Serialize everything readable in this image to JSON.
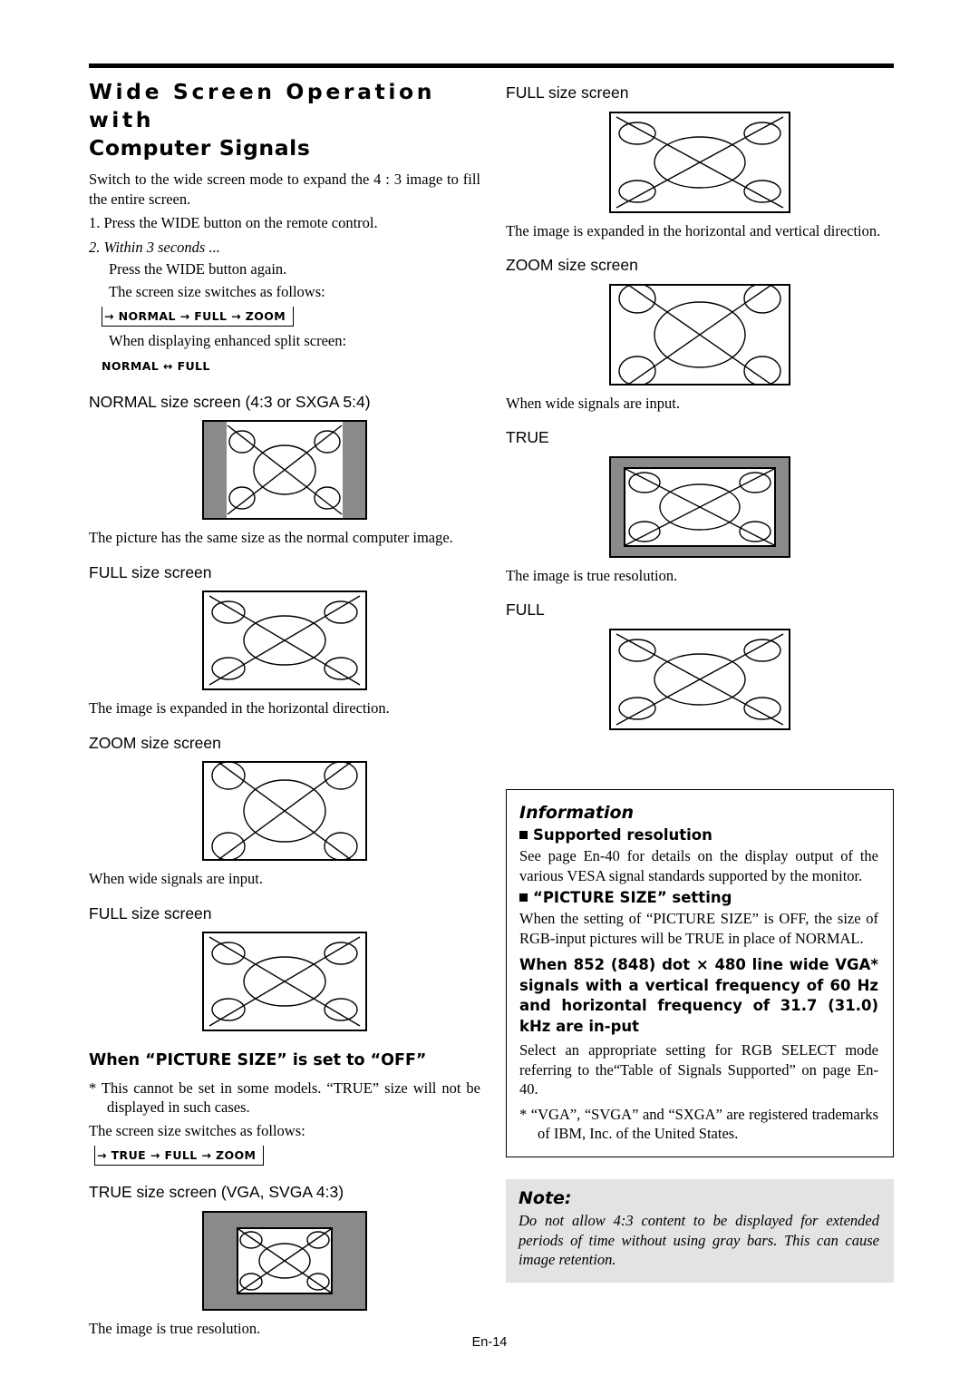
{
  "header": {
    "title_line1": "Wide  Screen  Operation  with",
    "title_line2": "Computer Signals"
  },
  "left": {
    "intro": "Switch to the wide screen mode to expand the 4 : 3 image to fill the entire screen.",
    "step1": "1. Press the WIDE button on the remote control.",
    "step2": "2. Within 3 seconds ...",
    "step2_line1": "Press the WIDE button again.",
    "step2_line2": "The screen size switches as follows:",
    "flow1": "→ NORMAL → FULL → ZOOM",
    "split_note": "When displaying enhanced split screen:",
    "flow2": "NORMAL ↔ FULL",
    "label_normal": "NORMAL size screen (4:3 or SXGA 5:4)",
    "caption_normal": "The picture has the same size as the normal computer image.",
    "label_full": "FULL size screen",
    "caption_full": "The image is expanded in the horizontal direction.",
    "label_zoom": "ZOOM size screen",
    "caption_zoom": "When wide signals are input.",
    "label_full2": "FULL size screen",
    "heading_picture_size": "When “PICTURE SIZE” is set to “OFF”",
    "star_note": "* This cannot be set in some models. “TRUE” size will not be displayed in such cases.",
    "switch_note": "The screen size switches as follows:",
    "flow3": "→ TRUE → FULL → ZOOM",
    "label_true": "TRUE size screen (VGA, SVGA 4:3)",
    "caption_true": "The image is true resolution."
  },
  "right": {
    "label_full": "FULL size screen",
    "caption_full": "The image is expanded in the horizontal and vertical direction.",
    "label_zoom": "ZOOM size screen",
    "caption_zoom": "When wide signals are input.",
    "label_true": "TRUE",
    "caption_true": "The image is true resolution.",
    "label_full2": "FULL"
  },
  "information": {
    "title": "Information",
    "sub1": "Supported resolution",
    "p1": "See page En-40 for details on the display output of the various VESA signal standards supported by the monitor.",
    "sub2": "“PICTURE SIZE” setting",
    "p2": "When the setting of “PICTURE SIZE” is OFF, the size of RGB-input pictures will be TRUE in place of NORMAL.",
    "bold_block": "When 852 (848) dot × 480 line wide VGA* signals with a vertical frequency of 60 Hz and horizontal frequency of 31.7 (31.0) kHz are in-put",
    "p3": "Select an appropriate setting for RGB SELECT mode referring to the“Table of Signals Supported” on page En-40.",
    "p4": "* “VGA”, “SVGA” and “SXGA” are registered trademarks of IBM, Inc. of the United States."
  },
  "note": {
    "title": "Note:",
    "text": "Do not allow 4:3 content to be displayed for extended periods of time without using gray bars. This can cause image retention."
  },
  "footer": {
    "page": "En-14"
  }
}
